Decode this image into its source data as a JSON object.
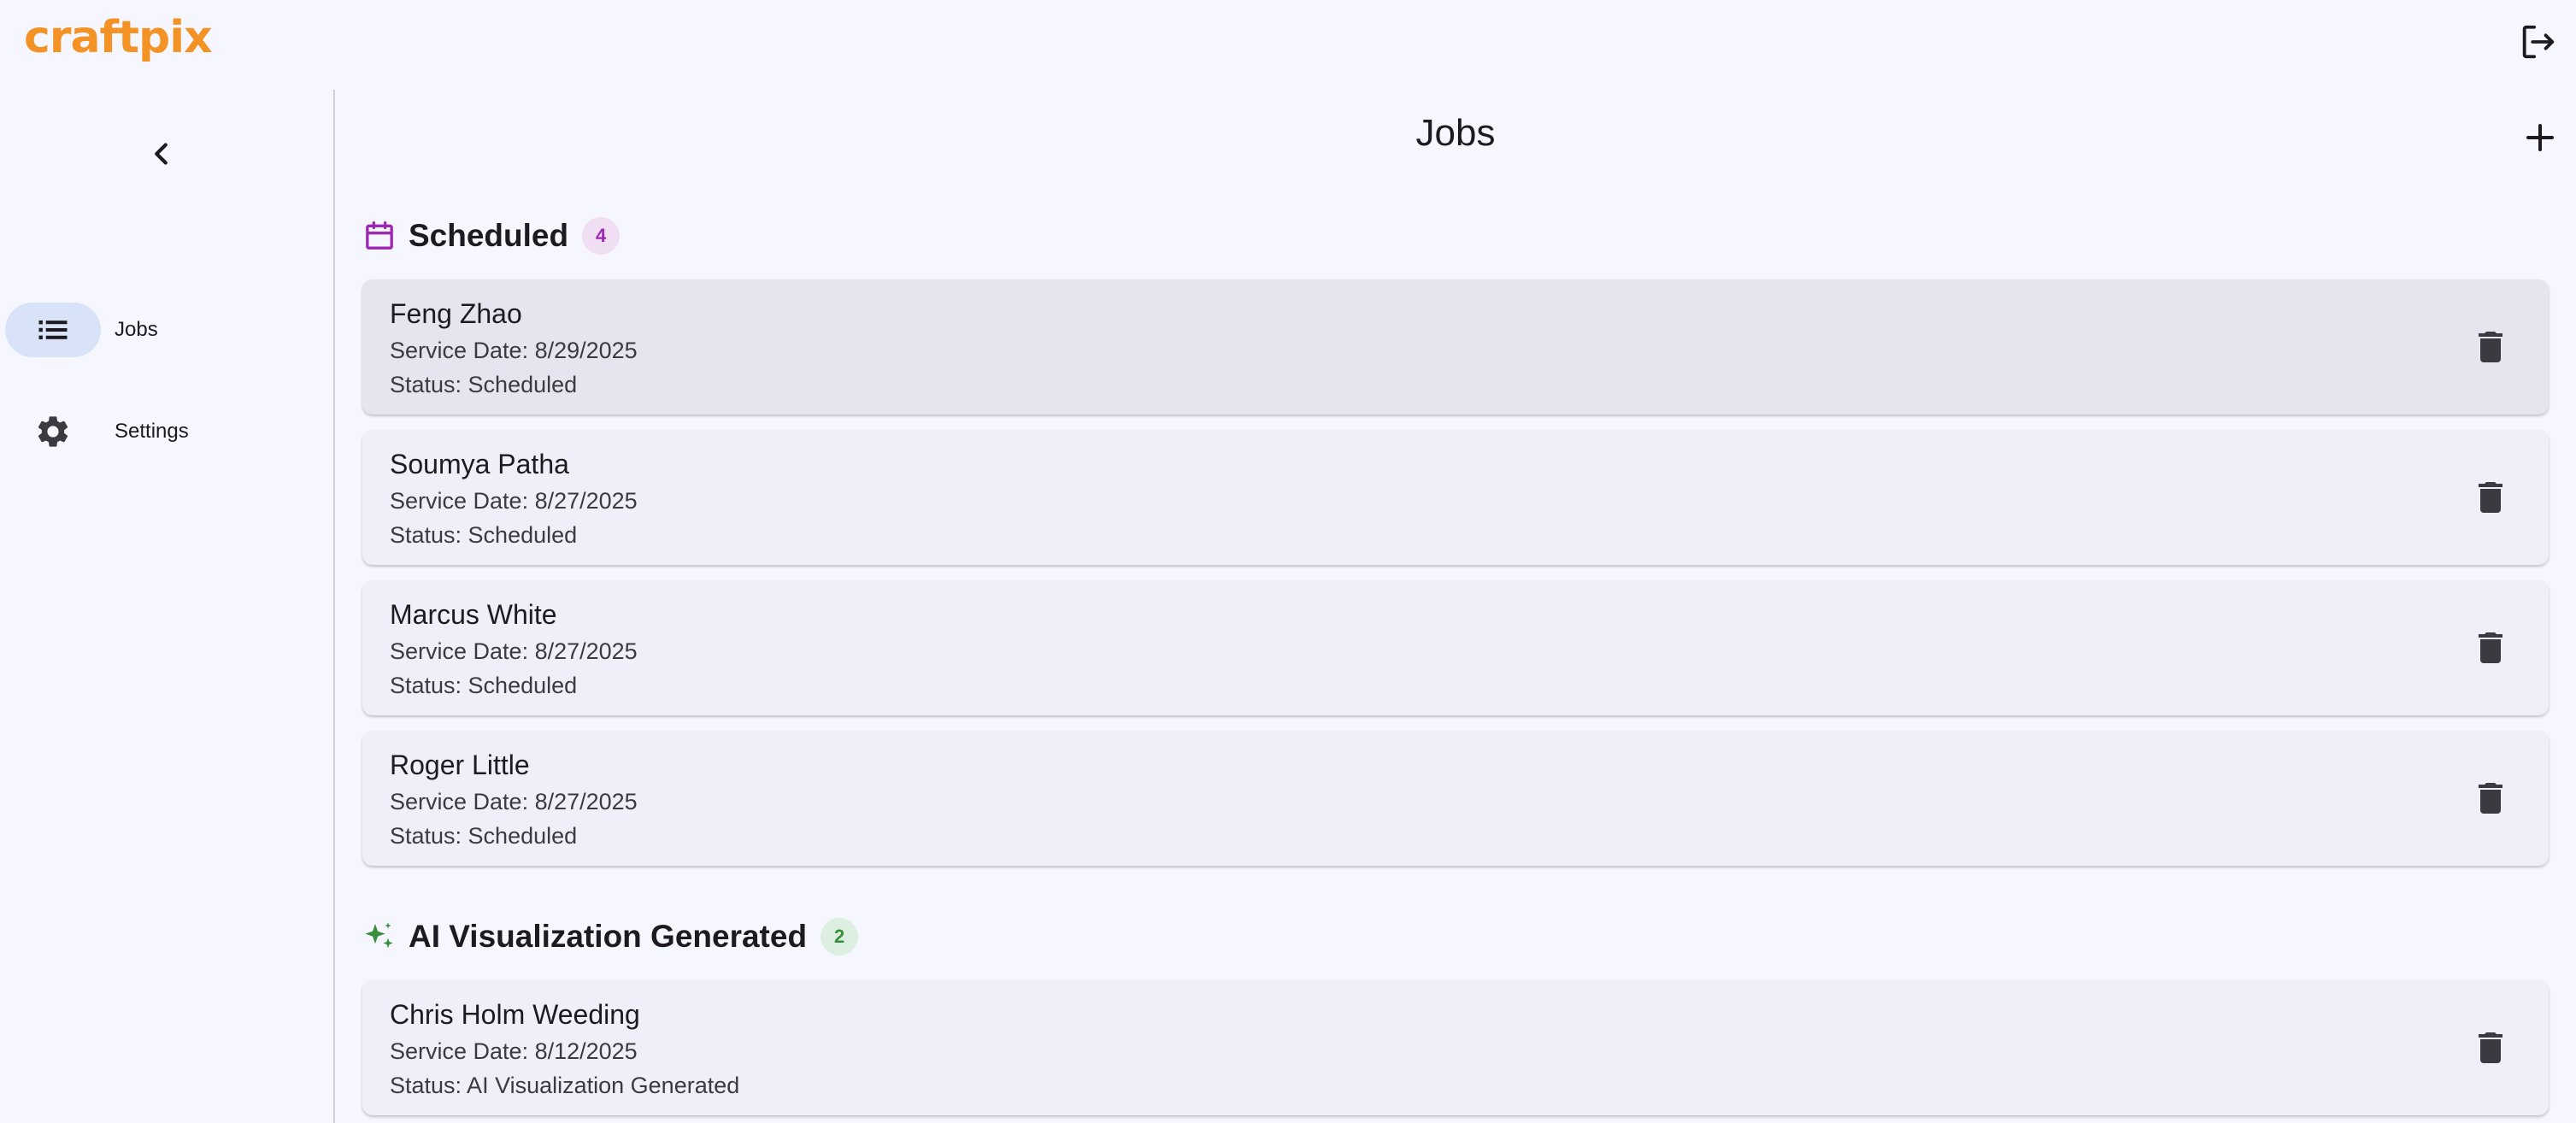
{
  "app": {
    "logo_text": "craftpix",
    "brand_color": "#f39325",
    "icons": {
      "logout": "logout-icon",
      "collapse": "chevron-left-icon",
      "add": "plus-icon",
      "delete": "trash-icon"
    }
  },
  "sidebar": {
    "items": [
      {
        "label": "Jobs",
        "icon": "list-icon",
        "active": true
      },
      {
        "label": "Settings",
        "icon": "gear-icon",
        "active": false
      }
    ]
  },
  "main": {
    "title": "Jobs",
    "sections": [
      {
        "title": "Scheduled",
        "count": "4",
        "icon": "calendar-icon",
        "color": "#9c27b0",
        "jobs": [
          {
            "name": "Feng Zhao",
            "date": "Service Date: 8/29/2025",
            "status": "Status: Scheduled"
          },
          {
            "name": "Soumya Patha",
            "date": "Service Date: 8/27/2025",
            "status": "Status: Scheduled"
          },
          {
            "name": "Marcus White",
            "date": "Service Date: 8/27/2025",
            "status": "Status: Scheduled"
          },
          {
            "name": "Roger Little",
            "date": "Service Date: 8/27/2025",
            "status": "Status: Scheduled"
          }
        ]
      },
      {
        "title": "AI Visualization Generated",
        "count": "2",
        "icon": "sparkle-icon",
        "color": "#388e3c",
        "jobs": [
          {
            "name": "Chris Holm Weeding",
            "date": "Service Date: 8/12/2025",
            "status": "Status: AI Visualization Generated"
          }
        ]
      }
    ]
  }
}
